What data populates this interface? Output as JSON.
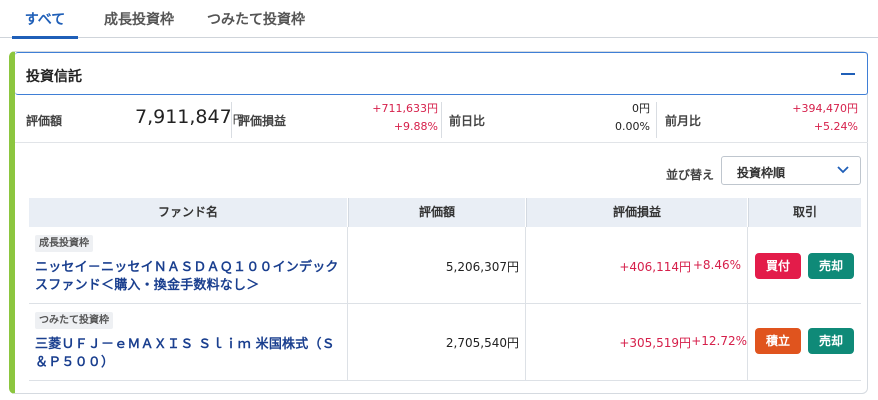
{
  "tabs": [
    {
      "label": "すべて",
      "active": true
    },
    {
      "label": "成長投資枠",
      "active": false
    },
    {
      "label": "つみたて投資枠",
      "active": false
    }
  ],
  "card": {
    "title": "投資信託",
    "summary": {
      "valuation_label": "評価額",
      "valuation_value": "7,911,847",
      "yen": "円",
      "pl_label": "評価損益",
      "pl_amount": "+711,633円",
      "pl_pct": "+9.88%",
      "day_label": "前日比",
      "day_amount": "0円",
      "day_pct": "0.00%",
      "month_label": "前月比",
      "month_amount": "+394,470円",
      "month_pct": "+5.24%"
    },
    "sort": {
      "label": "並び替え",
      "value": "投資枠順"
    },
    "table": {
      "headers": [
        "ファンド名",
        "評価額",
        "評価損益",
        "取引"
      ],
      "rows": [
        {
          "badge": "成長投資枠",
          "fund_name": "ニッセイ－ニッセイＮＡＳＤＡＱ１００インデックスファンド＜購入・換金手数料なし＞",
          "value": "5,206,307円",
          "pl_amount": "+406,114円",
          "pl_pct": "+8.46%",
          "btn1": "買付",
          "btn2": "売却"
        },
        {
          "badge": "つみたて投資枠",
          "fund_name": "三菱ＵＦＪ－ｅＭＡＸＩＳ Ｓｌｉｍ 米国株式（Ｓ＆Ｐ５００）",
          "value": "2,705,540円",
          "pl_amount": "+305,519円",
          "pl_pct": "+12.72%",
          "btn1": "積立",
          "btn2": "売却"
        }
      ]
    }
  },
  "colors": {
    "accent": "#1f5fb8",
    "positive": "#d6204b",
    "card_stripe": "#8cc63f",
    "buy": "#e31c4a",
    "accumulate": "#e0541e",
    "sell": "#0f8a78"
  }
}
